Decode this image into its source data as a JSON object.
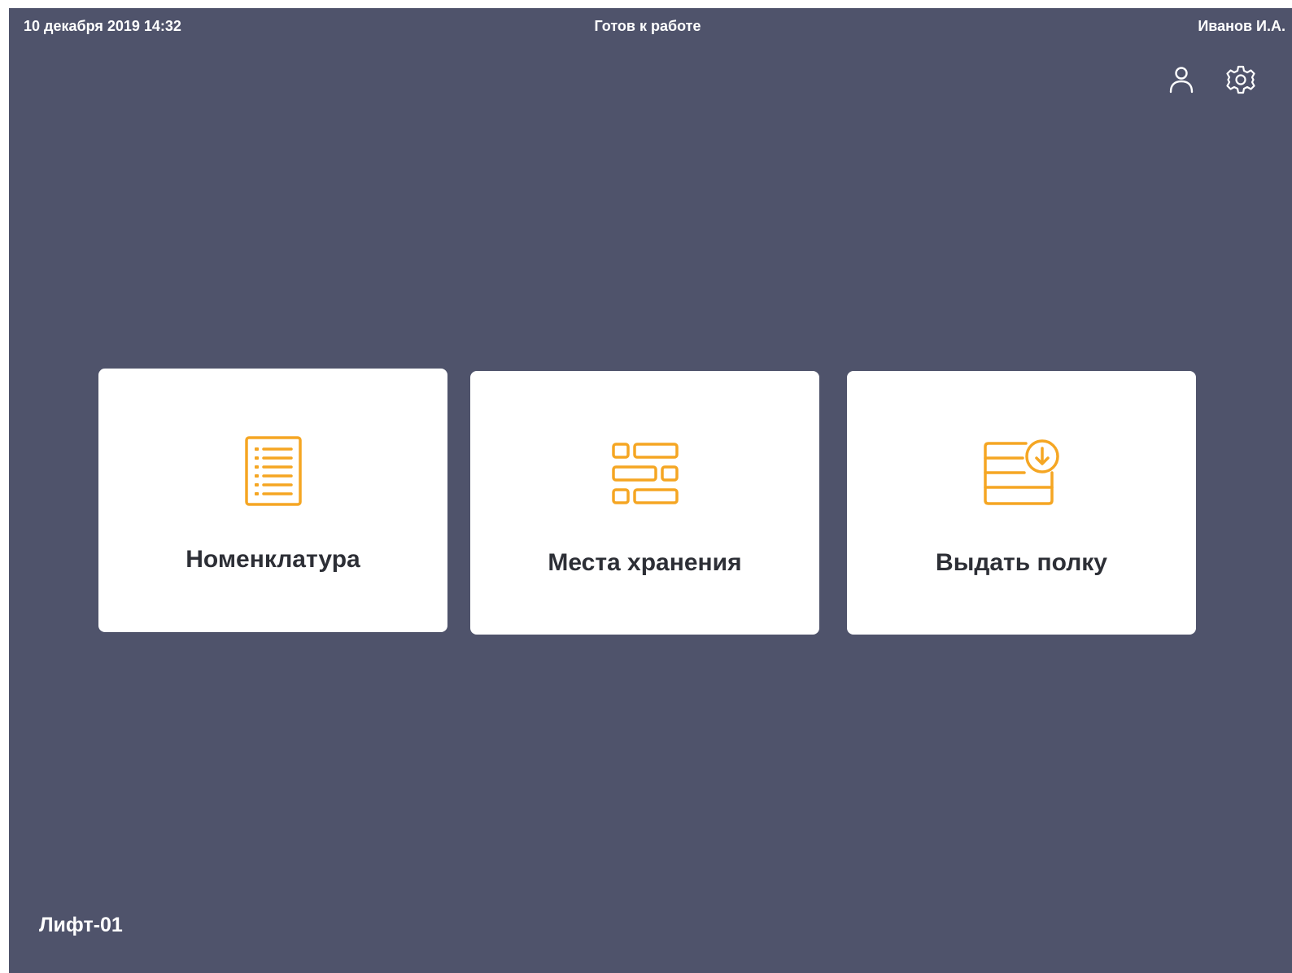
{
  "status_bar": {
    "datetime": "10 декабря 2019 14:32",
    "status": "Готов к работе",
    "user": "Иванов И.А."
  },
  "toolbar": {
    "icons": [
      "user-icon",
      "gear-icon"
    ]
  },
  "cards": [
    {
      "label": "Номенклатура",
      "icon": "list-document-icon"
    },
    {
      "label": "Места хранения",
      "icon": "storage-grid-icon"
    },
    {
      "label": "Выдать полку",
      "icon": "shelf-download-icon"
    }
  ],
  "footer": {
    "device_name": "Лифт-01"
  },
  "colors": {
    "background": "#4f536b",
    "card": "#ffffff",
    "accent": "#f5a623",
    "text_dark": "#2d2f36",
    "text_light": "#ffffff"
  }
}
